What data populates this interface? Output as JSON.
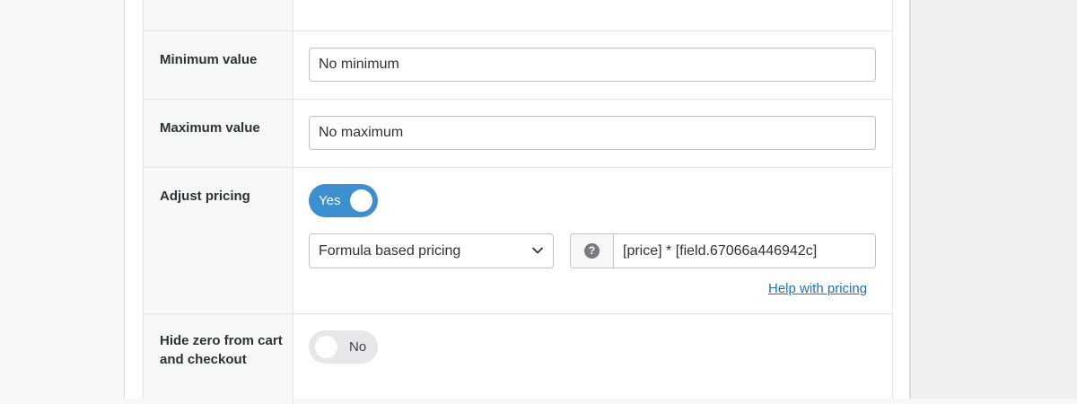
{
  "rows": {
    "minimum": {
      "label": "Minimum value",
      "value": "No minimum"
    },
    "maximum": {
      "label": "Maximum value",
      "value": "No maximum"
    },
    "adjust_pricing": {
      "label": "Adjust pricing",
      "toggle_label": "Yes",
      "toggle_on": true,
      "pricing_type": "Formula based pricing",
      "help_icon": "question-mark-icon",
      "formula": "[price] * [field.67066a446942c]",
      "help_link": "Help with pricing"
    },
    "hide_zero": {
      "label": "Hide zero from cart and checkout",
      "toggle_label": "No",
      "toggle_on": false
    }
  },
  "colors": {
    "toggle_on": "#3d8fd0",
    "toggle_off": "#e6e7e8",
    "link": "#2271b1"
  }
}
